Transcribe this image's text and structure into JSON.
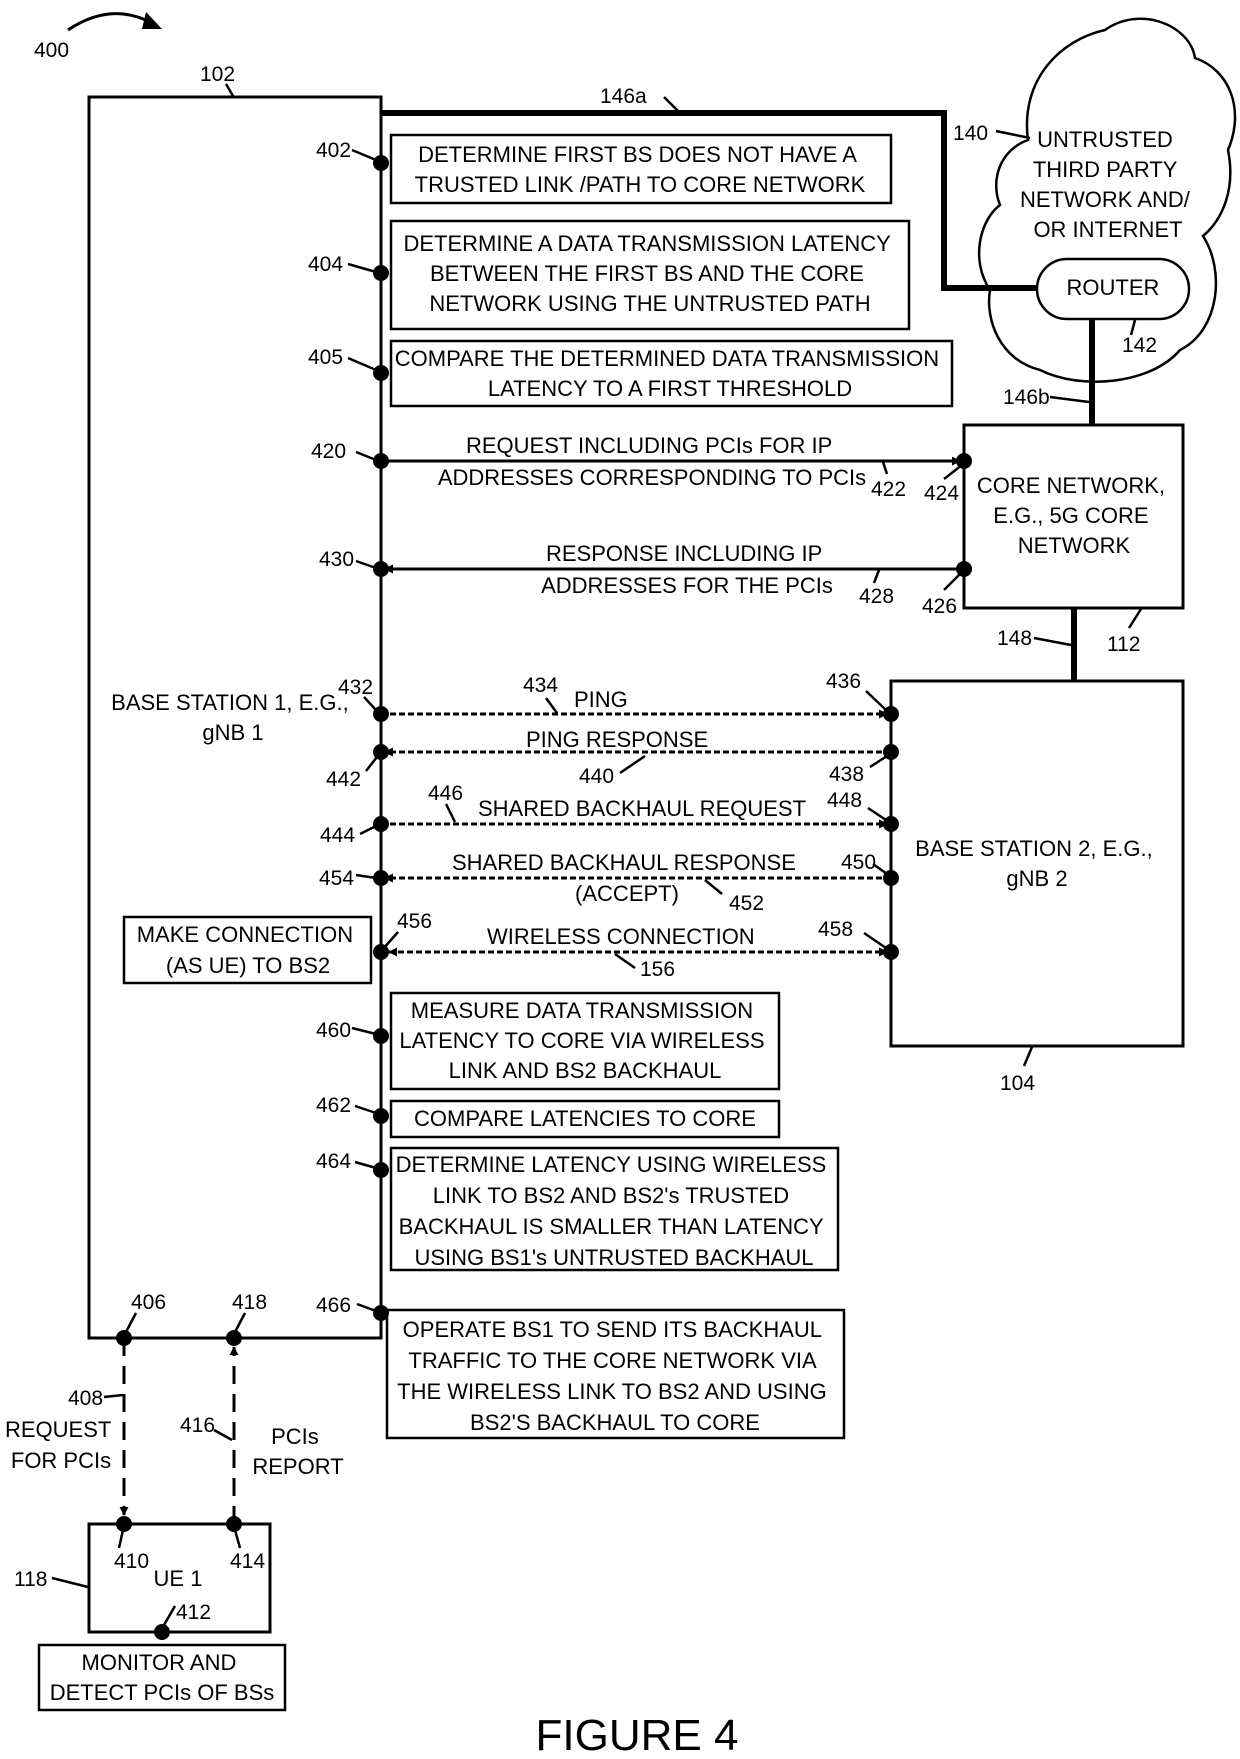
{
  "figure": {
    "ref_number": "400",
    "caption": "FIGURE 4"
  },
  "entities": {
    "bs1": {
      "ref": "102",
      "label_lines": [
        "BASE STATION 1, E.G.,",
        "gNB 1"
      ]
    },
    "cloud": {
      "ref": "140",
      "label_lines": [
        "UNTRUSTED",
        "THIRD PARTY",
        "NETWORK AND/",
        "OR INTERNET"
      ]
    },
    "router": {
      "ref": "142",
      "label": "ROUTER"
    },
    "core": {
      "ref": "112",
      "label_lines": [
        "CORE NETWORK,",
        "E.G., 5G CORE",
        "NETWORK"
      ]
    },
    "bs2": {
      "ref": "104",
      "label_lines": [
        "BASE STATION 2, E.G.,",
        "gNB 2"
      ]
    },
    "ue": {
      "ref": "118",
      "label": "UE 1"
    }
  },
  "links": {
    "untrusted_link_a": "146a",
    "untrusted_link_b": "146b",
    "trusted_backhaul": "148"
  },
  "steps": [
    {
      "ref": "402",
      "lines": [
        "DETERMINE FIRST BS DOES NOT HAVE A",
        "TRUSTED LINK /PATH TO CORE NETWORK"
      ]
    },
    {
      "ref": "404",
      "lines": [
        "DETERMINE A DATA TRANSMISSION LATENCY",
        "BETWEEN THE FIRST BS AND THE CORE",
        "NETWORK USING THE UNTRUSTED PATH"
      ]
    },
    {
      "ref": "405",
      "lines": [
        "COMPARE THE DETERMINED  DATA TRANSMISSION",
        "LATENCY TO A FIRST THRESHOLD"
      ]
    },
    {
      "ref": "456",
      "lines": [
        "MAKE CONNECTION",
        "(AS UE) TO BS2"
      ]
    },
    {
      "ref": "460",
      "lines": [
        "MEASURE DATA TRANSMISSION",
        "LATENCY TO CORE VIA WIRELESS",
        "LINK AND BS2 BACKHAUL"
      ]
    },
    {
      "ref": "462",
      "lines": [
        "COMPARE LATENCIES TO CORE"
      ]
    },
    {
      "ref": "464",
      "lines": [
        "DETERMINE LATENCY USING WIRELESS",
        "LINK TO BS2 AND BS2's TRUSTED",
        "BACKHAUL IS SMALLER THAN LATENCY",
        "USING BS1's UNTRUSTED BACKHAUL"
      ]
    },
    {
      "ref": "466",
      "lines": [
        "OPERATE BS1 TO SEND ITS BACKHAUL",
        "TRAFFIC TO THE CORE NETWORK VIA",
        "THE WIRELESS LINK TO BS2 AND USING",
        "BS2'S BACKHAUL TO CORE"
      ]
    },
    {
      "ref": "412",
      "lines": [
        "MONITOR AND",
        "DETECT PCIs OF  BSs"
      ]
    }
  ],
  "messages": [
    {
      "from_ref": "420",
      "to_ref": "424",
      "msg_ref": "422",
      "lines": [
        "REQUEST INCLUDING PCIs FOR IP",
        "ADDRESSES CORRESPONDING TO PCIs"
      ]
    },
    {
      "from_ref": "426",
      "to_ref": "430",
      "msg_ref": "428",
      "lines": [
        "RESPONSE INCLUDING IP",
        "ADDRESSES FOR THE PCIs"
      ]
    },
    {
      "from_ref": "432",
      "to_ref": "436",
      "msg_ref": "434",
      "lines": [
        "PING"
      ]
    },
    {
      "from_ref": "438",
      "to_ref": "442",
      "msg_ref": "440",
      "lines": [
        "PING RESPONSE"
      ]
    },
    {
      "from_ref": "444",
      "to_ref": "448",
      "msg_ref": "446",
      "lines": [
        "SHARED BACKHAUL REQUEST"
      ]
    },
    {
      "from_ref": "450",
      "to_ref": "454",
      "msg_ref": "452",
      "lines": [
        "SHARED BACKHAUL RESPONSE",
        "(ACCEPT)"
      ]
    },
    {
      "from_ref": "456",
      "to_ref": "458",
      "msg_ref": "156",
      "lines": [
        "WIRELESS CONNECTION"
      ]
    },
    {
      "from_ref": "406",
      "to_ref": "410",
      "msg_ref": "408",
      "lines": [
        "REQUEST",
        "FOR PCIs"
      ]
    },
    {
      "from_ref": "414",
      "to_ref": "418",
      "msg_ref": "416",
      "lines": [
        "PCIs",
        "REPORT"
      ]
    }
  ]
}
